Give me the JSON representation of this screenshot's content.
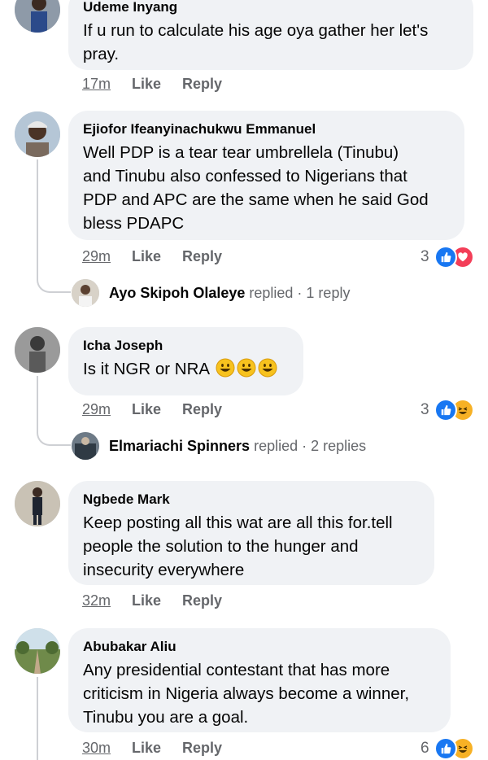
{
  "comments": [
    {
      "author": "Udeme Inyang",
      "text": "If u run to calculate his age oya gather her let's\npray.",
      "time": "17m"
    },
    {
      "author": "Ejiofor Ifeanyinachukwu Emmanuel",
      "text": "Well PDP is a  tear tear umbrellela (Tinubu)\nand Tinubu also confessed to Nigerians that\nPDP and APC are the same when he said God\nbless PDAPC",
      "time": "29m",
      "reaction_count": "3",
      "reply_name": "Ayo Skipoh Olaleye",
      "reply_text": "replied · 1 reply"
    },
    {
      "author": "Icha Joseph",
      "text": "Is it NGR or NRA",
      "time": "29m",
      "reaction_count": "3",
      "reply_name": "Elmariachi Spinners",
      "reply_text": "replied · 2 replies"
    },
    {
      "author": "Ngbede Mark",
      "text": "Keep posting all this wat are all this for.tell\npeople the solution to the hunger and\ninsecurity everywhere",
      "time": "32m"
    },
    {
      "author": "Abubakar Aliu",
      "text": "Any presidential contestant that has more\ncriticism in Nigeria always become a winner,\nTinubu you are a goal.",
      "time": "30m",
      "reaction_count": "6"
    }
  ],
  "actions": {
    "like": "Like",
    "reply": "Reply"
  },
  "icons": {
    "like": "thumbs-up-icon",
    "love": "heart-icon",
    "haha": "laughing-face-icon",
    "grin": "grinning-face-emoji"
  },
  "colors": {
    "bubble": "#f0f2f5",
    "like_blue": "#1877f2",
    "love_red": "#f33e58",
    "haha_yellow": "#f7b125",
    "meta_gray": "#65676b"
  }
}
